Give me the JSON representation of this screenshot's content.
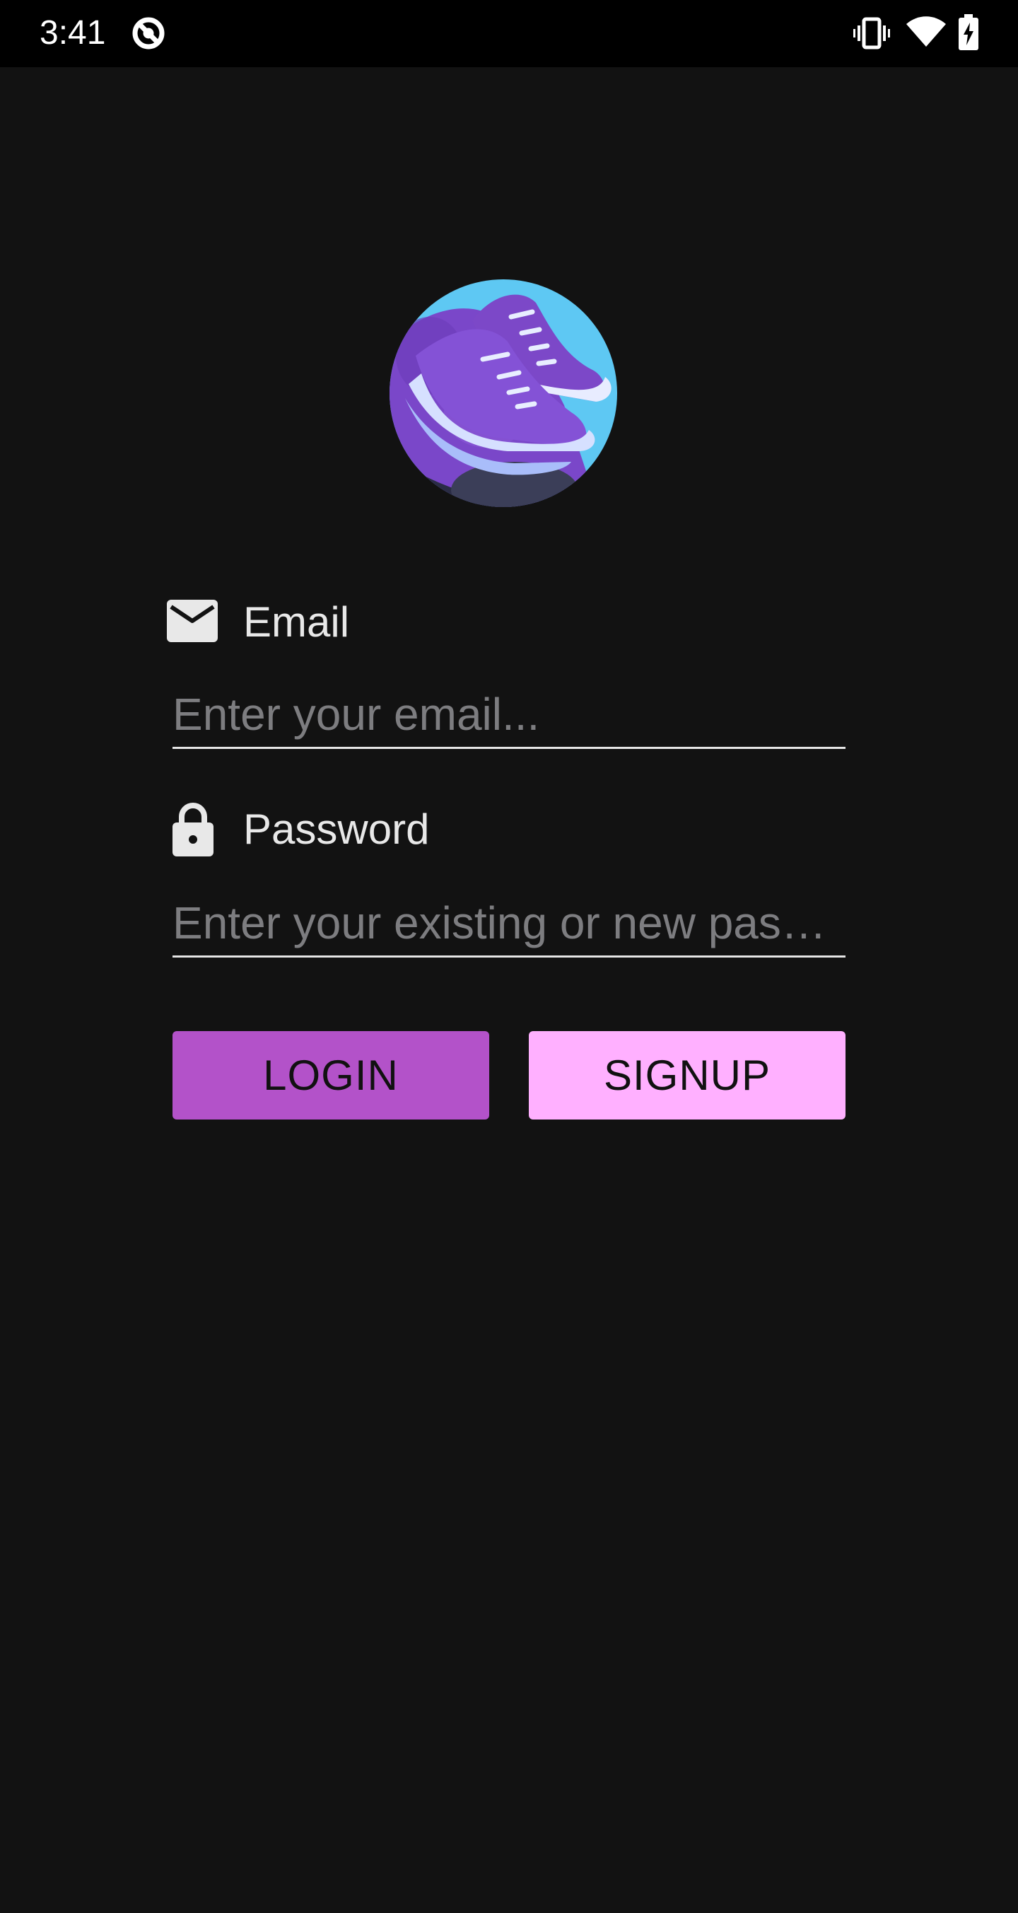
{
  "status_bar": {
    "time": "3:41",
    "icons": [
      "do-not-disturb-icon",
      "vibrate-icon",
      "wifi-icon",
      "battery-charging-icon"
    ]
  },
  "logo": {
    "icon": "sneaker-icon"
  },
  "email": {
    "label": "Email",
    "icon": "mail-icon",
    "placeholder": "Enter your email...",
    "value": ""
  },
  "password": {
    "label": "Password",
    "icon": "lock-icon",
    "placeholder": "Enter your existing or new password",
    "value": ""
  },
  "buttons": {
    "login_label": "LOGIN",
    "signup_label": "SIGNUP"
  },
  "colors": {
    "background": "#121212",
    "status_bar": "#000000",
    "login_button": "#b352c9",
    "signup_button": "#ffb0ff",
    "logo_circle": "#5ec8f3",
    "shoe_purple": "#7c48c8"
  }
}
